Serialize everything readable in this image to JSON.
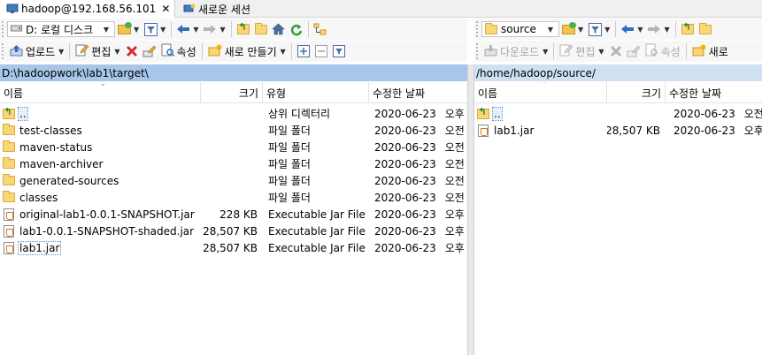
{
  "tabs": [
    {
      "label": "hadoop@192.168.56.101",
      "close": "✕"
    },
    {
      "label": "새로운 세션"
    }
  ],
  "left_toolbar": {
    "drive": "D: 로컬 디스크",
    "upload": "업로드",
    "edit": "편집",
    "properties": "속성",
    "new_create": "새로 만들기"
  },
  "right_toolbar": {
    "location": "source",
    "download": "다운로드",
    "edit": "편집",
    "properties": "속성",
    "new_create": "새로"
  },
  "left_panel": {
    "path": "D:\\hadoopwork\\lab1\\target\\",
    "columns": {
      "name": "이름",
      "size": "크기",
      "type": "유형",
      "modified": "수정한 날짜"
    },
    "rows": [
      {
        "icon": "parent-dir-icon",
        "name": "..",
        "size": "",
        "type": "상위 디렉터리",
        "date": "2020-06-23",
        "time": "오후"
      },
      {
        "icon": "folder-icon",
        "name": "test-classes",
        "size": "",
        "type": "파일 폴더",
        "date": "2020-06-23",
        "time": "오전"
      },
      {
        "icon": "folder-icon",
        "name": "maven-status",
        "size": "",
        "type": "파일 폴더",
        "date": "2020-06-23",
        "time": "오전"
      },
      {
        "icon": "folder-icon",
        "name": "maven-archiver",
        "size": "",
        "type": "파일 폴더",
        "date": "2020-06-23",
        "time": "오전"
      },
      {
        "icon": "folder-icon",
        "name": "generated-sources",
        "size": "",
        "type": "파일 폴더",
        "date": "2020-06-23",
        "time": "오전"
      },
      {
        "icon": "folder-icon",
        "name": "classes",
        "size": "",
        "type": "파일 폴더",
        "date": "2020-06-23",
        "time": "오전"
      },
      {
        "icon": "jar-file-icon",
        "name": "original-lab1-0.0.1-SNAPSHOT.jar",
        "size": "228 KB",
        "type": "Executable Jar File",
        "date": "2020-06-23",
        "time": "오후"
      },
      {
        "icon": "jar-file-icon",
        "name": "lab1-0.0.1-SNAPSHOT-shaded.jar",
        "size": "28,507 KB",
        "type": "Executable Jar File",
        "date": "2020-06-23",
        "time": "오후"
      },
      {
        "icon": "jar-file-icon",
        "name": "lab1.jar",
        "size": "28,507 KB",
        "type": "Executable Jar File",
        "date": "2020-06-23",
        "time": "오후"
      }
    ]
  },
  "right_panel": {
    "path": "/home/hadoop/source/",
    "columns": {
      "name": "이름",
      "size": "크기",
      "modified": "수정한 날짜"
    },
    "rows": [
      {
        "icon": "parent-dir-icon",
        "name": "..",
        "size": "",
        "date": "2020-06-23",
        "time": "오전"
      },
      {
        "icon": "jar-file-icon",
        "name": "lab1.jar",
        "size": "28,507 KB",
        "date": "2020-06-23",
        "time": "오후"
      }
    ]
  },
  "colors": {
    "path_active": "#a8c6e9",
    "path_inactive": "#cfe0f3",
    "folder": "#f8d775",
    "selection": "#e5f0fb"
  }
}
